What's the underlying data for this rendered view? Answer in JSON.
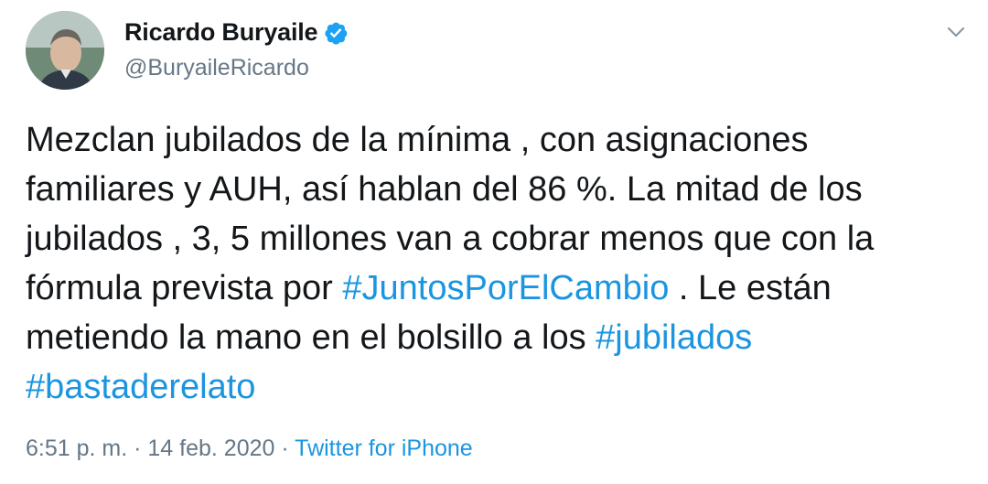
{
  "author": {
    "display_name": "Ricardo Buryaile",
    "handle": "@BuryaileRicardo",
    "verified": true
  },
  "icons": {
    "verified": "verified-badge-icon",
    "menu": "chevron-down-icon"
  },
  "tweet": {
    "lines": [
      {
        "parts": [
          {
            "text": "Mezclan jubilados de la mínima , con asignaciones",
            "type": "text"
          }
        ]
      },
      {
        "parts": [
          {
            "text": "familiares y AUH, así hablan del 86 %. La mitad de los",
            "type": "text"
          }
        ]
      },
      {
        "parts": [
          {
            "text": "jubilados , 3, 5 millones van a cobrar menos que con la",
            "type": "text"
          }
        ]
      },
      {
        "parts": [
          {
            "text": "fórmula prevista por ",
            "type": "text"
          },
          {
            "text": "#JuntosPorElCambio",
            "type": "hashtag"
          },
          {
            "text": " . Le están",
            "type": "text"
          }
        ]
      },
      {
        "parts": [
          {
            "text": "metiendo la mano en el bolsillo a los ",
            "type": "text"
          },
          {
            "text": "#jubilados",
            "type": "hashtag"
          }
        ]
      },
      {
        "parts": [
          {
            "text": "#bastaderelato",
            "type": "hashtag"
          }
        ]
      }
    ]
  },
  "meta": {
    "time": "6:51 p. m.",
    "separator1": " · ",
    "date": "14 feb. 2020",
    "separator2": " · ",
    "source": "Twitter for iPhone"
  },
  "colors": {
    "link": "#1b95e0",
    "verified": "#1da1f2",
    "secondary_text": "#657786",
    "primary_text": "#14171a"
  }
}
